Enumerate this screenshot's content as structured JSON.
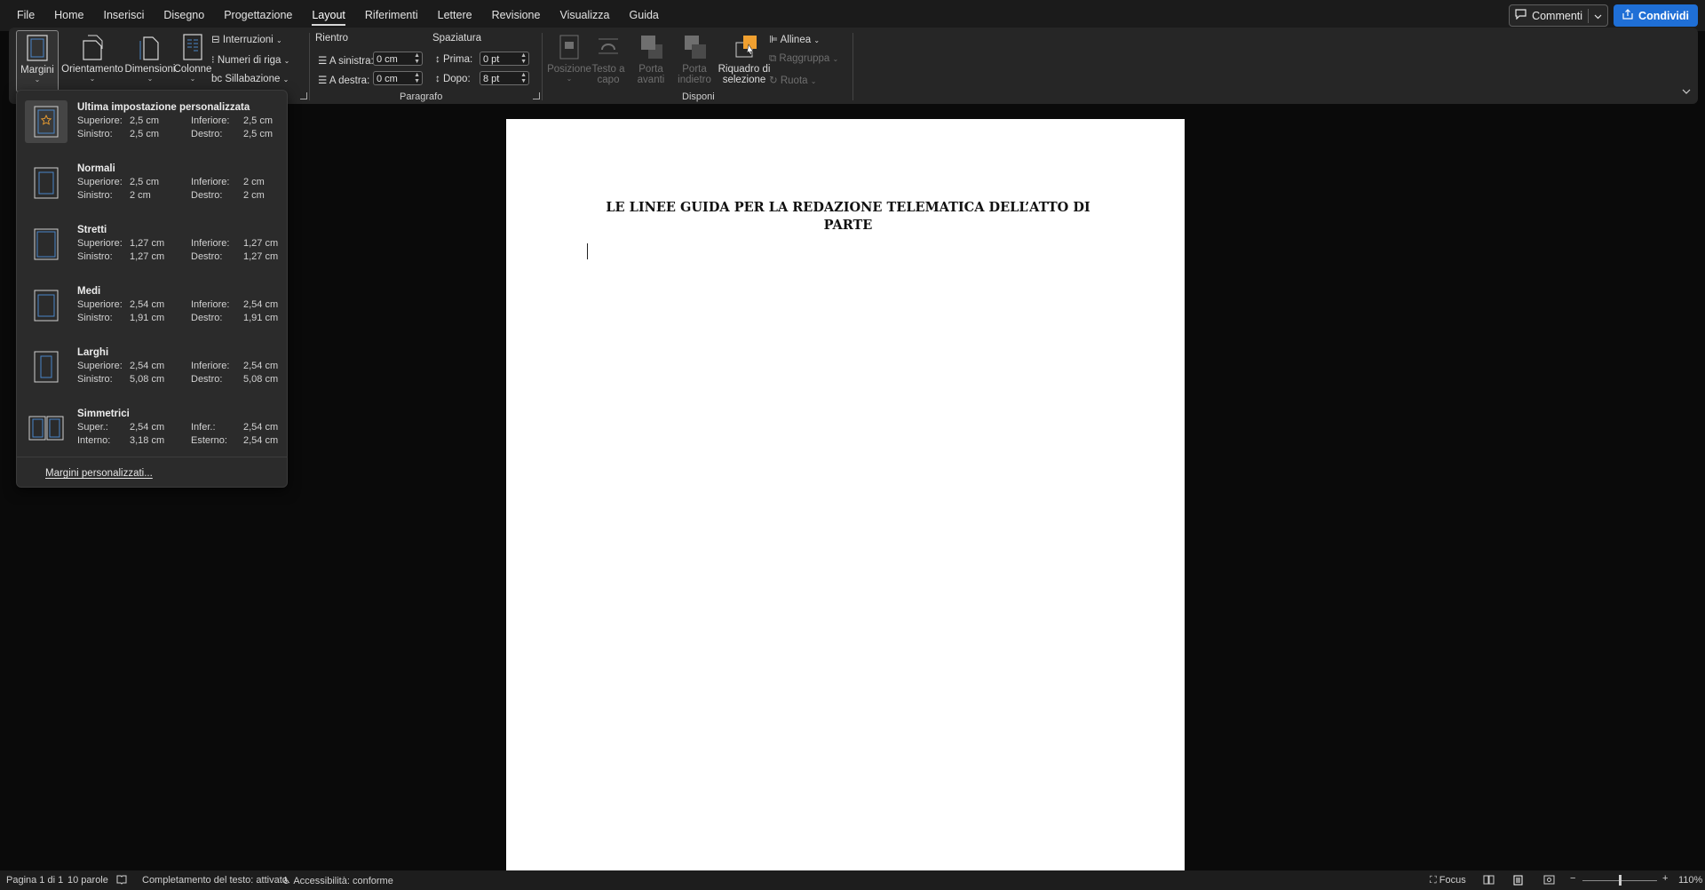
{
  "menu": {
    "items": [
      "File",
      "Home",
      "Inserisci",
      "Disegno",
      "Progettazione",
      "Layout",
      "Riferimenti",
      "Lettere",
      "Revisione",
      "Visualizza",
      "Guida"
    ],
    "active": "Layout",
    "comments_label": "Commenti",
    "share_label": "Condividi"
  },
  "ribbon": {
    "margins": "Margini",
    "orientation": "Orientamento",
    "size": "Dimensioni",
    "columns": "Colonne",
    "breaks": "Interruzioni",
    "line_numbers": "Numeri di riga",
    "hyphenation": "Sillabazione",
    "indent_title": "Rientro",
    "indent_left_label": "A sinistra:",
    "indent_left_value": "0 cm",
    "indent_right_label": "A destra:",
    "indent_right_value": "0 cm",
    "spacing_title": "Spaziatura",
    "spacing_before_label": "Prima:",
    "spacing_before_value": "0 pt",
    "spacing_after_label": "Dopo:",
    "spacing_after_value": "8 pt",
    "paragraph_group": "Paragrafo",
    "position_1": "Posizione",
    "wrap_1": "Testo a",
    "wrap_2": "capo",
    "forward_1": "Porta",
    "forward_2": "avanti",
    "backward_1": "Porta",
    "backward_2": "indietro",
    "selection_1": "Riquadro di",
    "selection_2": "selezione",
    "align": "Allinea",
    "group": "Raggruppa",
    "rotate": "Ruota",
    "arrange_group": "Disponi"
  },
  "margins_menu": {
    "options": [
      {
        "name": "Ultima impostazione personalizzata",
        "l1": "Superiore:",
        "v1": "2,5 cm",
        "l2": "Inferiore:",
        "v2": "2,5 cm",
        "l3": "Sinistro:",
        "v3": "2,5 cm",
        "l4": "Destro:",
        "v4": "2,5 cm"
      },
      {
        "name": "Normali",
        "l1": "Superiore:",
        "v1": "2,5 cm",
        "l2": "Inferiore:",
        "v2": "2 cm",
        "l3": "Sinistro:",
        "v3": "2 cm",
        "l4": "Destro:",
        "v4": "2 cm"
      },
      {
        "name": "Stretti",
        "l1": "Superiore:",
        "v1": "1,27 cm",
        "l2": "Inferiore:",
        "v2": "1,27 cm",
        "l3": "Sinistro:",
        "v3": "1,27 cm",
        "l4": "Destro:",
        "v4": "1,27 cm"
      },
      {
        "name": "Medi",
        "l1": "Superiore:",
        "v1": "2,54 cm",
        "l2": "Inferiore:",
        "v2": "2,54 cm",
        "l3": "Sinistro:",
        "v3": "1,91 cm",
        "l4": "Destro:",
        "v4": "1,91 cm"
      },
      {
        "name": "Larghi",
        "l1": "Superiore:",
        "v1": "2,54 cm",
        "l2": "Inferiore:",
        "v2": "2,54 cm",
        "l3": "Sinistro:",
        "v3": "5,08 cm",
        "l4": "Destro:",
        "v4": "5,08 cm"
      },
      {
        "name": "Simmetrici",
        "l1": "Super.:",
        "v1": "2,54 cm",
        "l2": "Infer.:",
        "v2": "2,54 cm",
        "l3": "Interno:",
        "v3": "3,18 cm",
        "l4": "Esterno:",
        "v4": "2,54 cm"
      }
    ],
    "custom_label": "Margini personalizzati..."
  },
  "document": {
    "title_line1": "LE LINEE GUIDA PER LA REDAZIONE TELEMATICA DELL’ATTO DI",
    "title_line2": "PARTE"
  },
  "status": {
    "page": "Pagina 1 di 1",
    "words": "10 parole",
    "autocomplete": "Completamento del testo: attivato",
    "accessibility": "Accessibilità: conforme",
    "focus": "Focus",
    "zoom": "110%"
  },
  "colors": {
    "accent_blue": "#1f6fd6",
    "selection_orange": "#f0a030",
    "thumb_margin_blue": "#4a86c8"
  }
}
